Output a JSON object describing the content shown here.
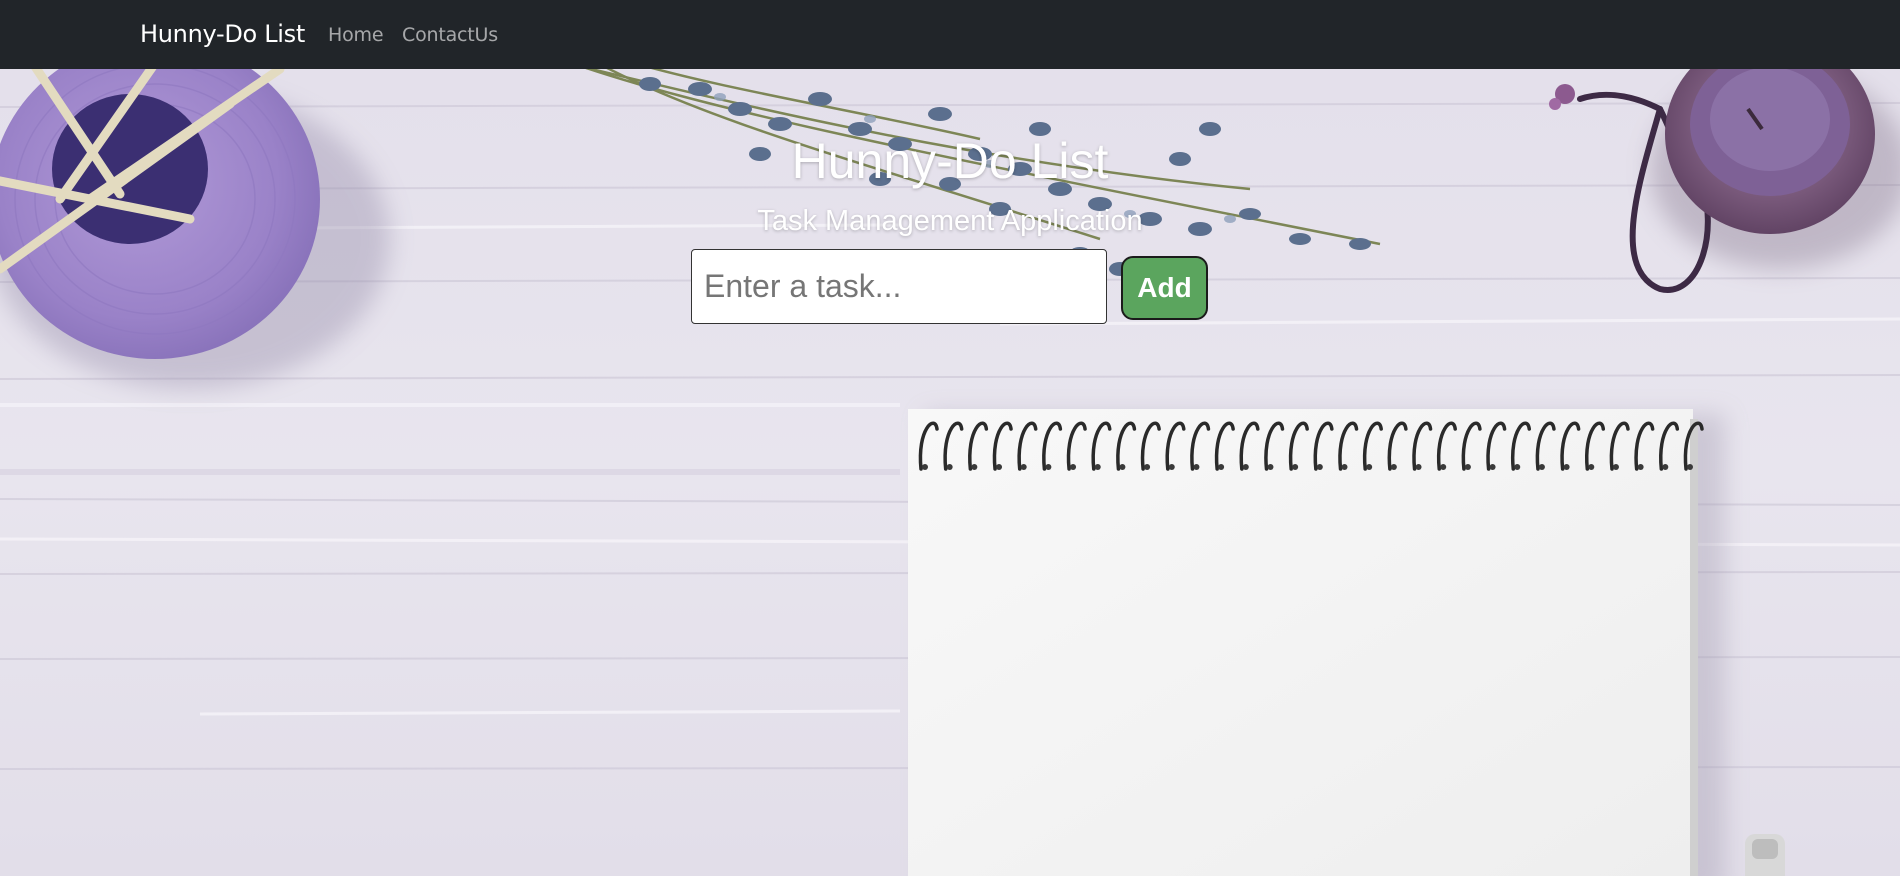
{
  "navbar": {
    "brand": "Hunny-Do List",
    "links": [
      {
        "label": "Home"
      },
      {
        "label": "ContactUs"
      }
    ]
  },
  "hero": {
    "title": "Hunny-Do List",
    "subtitle": "Task Management Application"
  },
  "task_form": {
    "input_value": "",
    "input_placeholder": "Enter a task...",
    "add_label": "Add"
  },
  "colors": {
    "navbar_bg": "#212529",
    "add_button_bg": "#5ba55e",
    "background": "#e6e3ec"
  }
}
